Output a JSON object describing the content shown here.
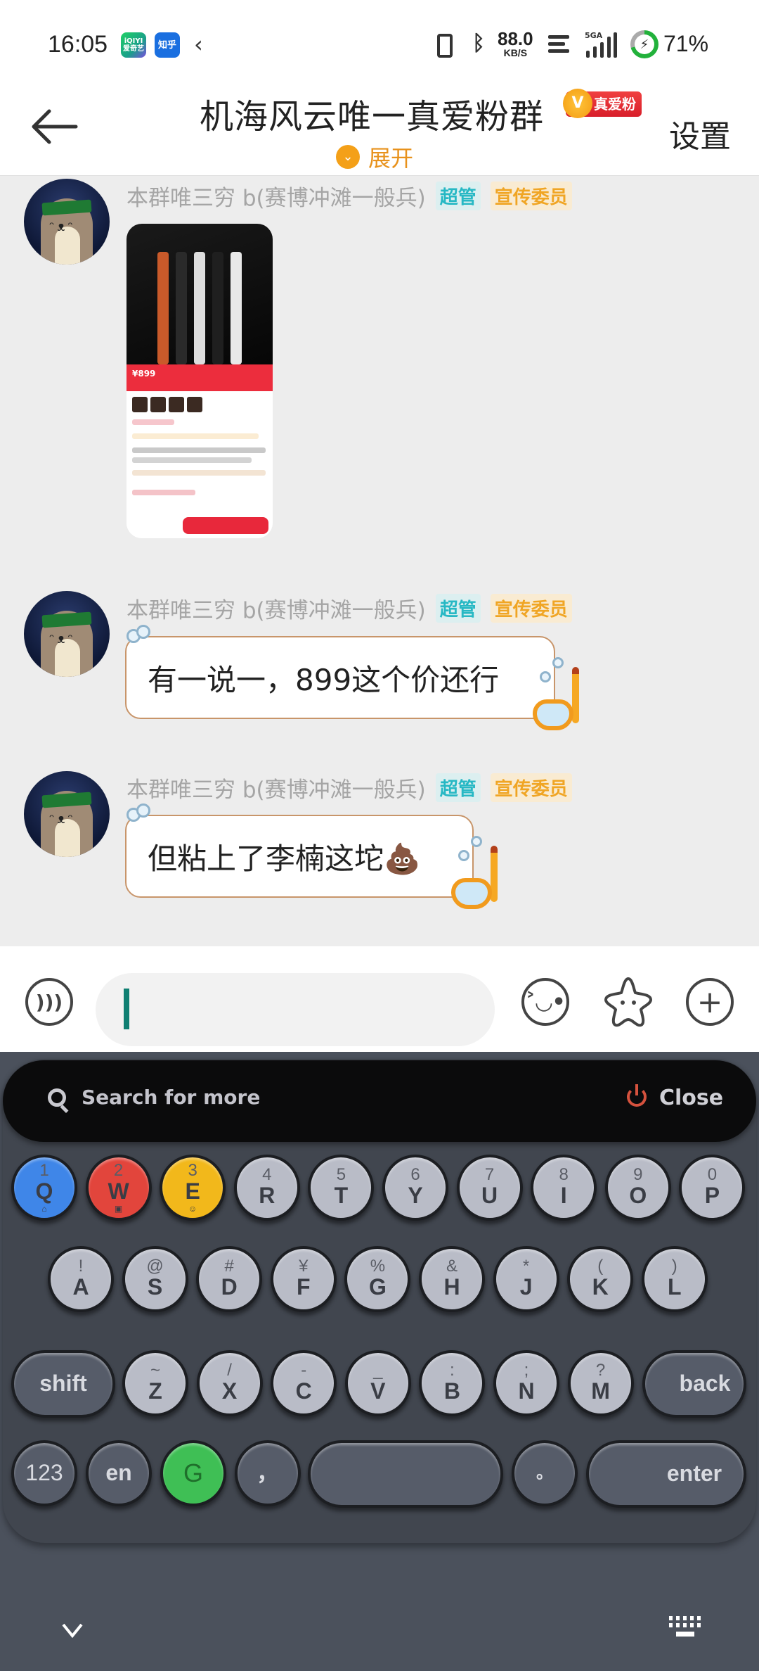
{
  "status_bar": {
    "time": "16:05",
    "apps": [
      {
        "name": "iqiyi",
        "label_top": "iQIYI",
        "label_bottom": "爱奇艺"
      },
      {
        "name": "zhihu",
        "label_top": "知乎",
        "label_bottom": ""
      }
    ],
    "back_chevron": "‹",
    "net_speed_value": "88.0",
    "net_speed_unit": "KB/S",
    "signal_label": "5GA",
    "battery_percent": 71,
    "battery_label": "71%",
    "battery_color": "#22b13b"
  },
  "header": {
    "title": "机海风云唯一真爱粉群",
    "fan_badge": "真爱粉",
    "fan_badge_icon": "V",
    "expand_label": "展开",
    "expand_icon": "⌄",
    "settings_label": "设置"
  },
  "messages": [
    {
      "sender": "本群唯三穷 b(赛博冲滩一般兵)",
      "roles": [
        "超管",
        "宣传委员"
      ],
      "type": "image",
      "image": {
        "price_text": "¥899",
        "description": "keyboard product page screenshot"
      }
    },
    {
      "sender": "本群唯三穷 b(赛博冲滩一般兵)",
      "roles": [
        "超管",
        "宣传委员"
      ],
      "type": "text",
      "text": "有一说一，899这个价还行"
    },
    {
      "sender": "本群唯三穷 b(赛博冲滩一般兵)",
      "roles": [
        "超管",
        "宣传委员"
      ],
      "type": "text",
      "text": "但粘上了李楠这坨💩"
    }
  ],
  "input_bar": {
    "voice_icon": "voice-icon",
    "message_value": "",
    "emoji_icon": "emoji-icon",
    "sticker_icon": "sticker-icon",
    "plus_icon": "plus-icon"
  },
  "keyboard": {
    "search_label": "Search for more",
    "close_label": "Close",
    "row1": [
      {
        "main": "Q",
        "sub": "1",
        "mini": "⌂",
        "color": "blue"
      },
      {
        "main": "W",
        "sub": "2",
        "mini": "▣",
        "color": "red"
      },
      {
        "main": "E",
        "sub": "3",
        "mini": "☺",
        "color": "yellow"
      },
      {
        "main": "R",
        "sub": "4"
      },
      {
        "main": "T",
        "sub": "5"
      },
      {
        "main": "Y",
        "sub": "6"
      },
      {
        "main": "U",
        "sub": "7"
      },
      {
        "main": "I",
        "sub": "8"
      },
      {
        "main": "O",
        "sub": "9"
      },
      {
        "main": "P",
        "sub": "0"
      }
    ],
    "row2": [
      {
        "main": "A",
        "sub": "!"
      },
      {
        "main": "S",
        "sub": "@"
      },
      {
        "main": "D",
        "sub": "#"
      },
      {
        "main": "F",
        "sub": "¥"
      },
      {
        "main": "G",
        "sub": "%"
      },
      {
        "main": "H",
        "sub": "&"
      },
      {
        "main": "J",
        "sub": "*"
      },
      {
        "main": "K",
        "sub": "("
      },
      {
        "main": "L",
        "sub": ")"
      }
    ],
    "row3": [
      {
        "main": "Z",
        "sub": "~"
      },
      {
        "main": "X",
        "sub": "/"
      },
      {
        "main": "C",
        "sub": "-"
      },
      {
        "main": "V",
        "sub": "_"
      },
      {
        "main": "B",
        "sub": ":"
      },
      {
        "main": "N",
        "sub": ";"
      },
      {
        "main": "M",
        "sub": "?"
      }
    ],
    "shift_label": "shift",
    "back_label": "back",
    "num_label": "123",
    "lang_label": "en",
    "g_label": "G",
    "comma_label": "，",
    "space_label": "",
    "period_label": "。",
    "enter_label": "enter",
    "hide_icon": "chevron-down-icon",
    "switch_icon": "keyboard-icon"
  }
}
